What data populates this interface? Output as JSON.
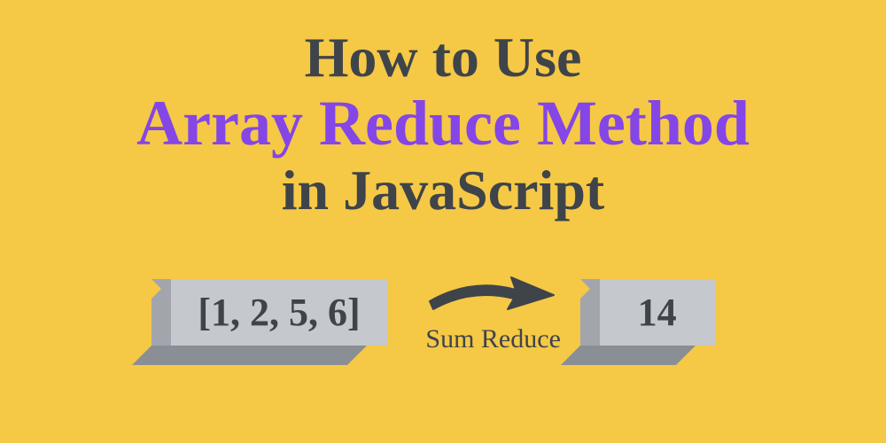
{
  "title": {
    "line1": "How to Use",
    "line2": "Array Reduce Method",
    "line3": "in JavaScript"
  },
  "diagram": {
    "input_array": "[1, 2, 5, 6]",
    "arrow_label": "Sum Reduce",
    "output_value": "14"
  },
  "colors": {
    "background": "#f5c846",
    "text_dark": "#3e4449",
    "text_accent": "#8446e6",
    "block_face": "#c5c8cc",
    "block_side": "#a2a6ac",
    "block_bottom": "#8a8e95"
  }
}
